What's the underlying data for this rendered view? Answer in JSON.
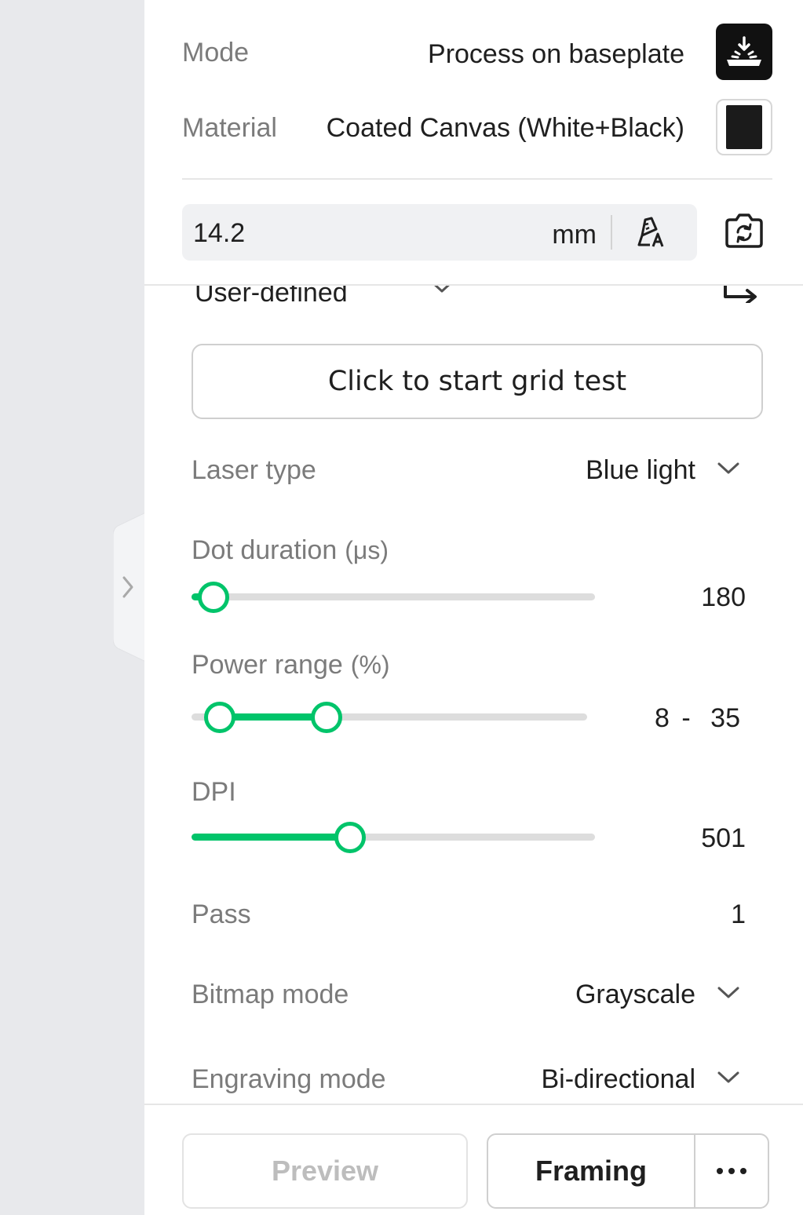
{
  "mode": {
    "label": "Mode",
    "value": "Process on baseplate",
    "icon": "laser-baseplate-icon"
  },
  "material": {
    "label": "Material",
    "value": "Coated Canvas (White+Black)",
    "swatch_color": "#1b1b1b"
  },
  "height": {
    "value": "14.2",
    "unit": "mm",
    "auto_icon": "auto-measure-icon",
    "camera_icon": "camera-refresh-icon"
  },
  "preset": {
    "value": "User-defined",
    "export_icon": "export-arrow-icon"
  },
  "grid_test": {
    "label": "Click to start grid test"
  },
  "laser_type": {
    "label": "Laser type",
    "value": "Blue light"
  },
  "dot_duration": {
    "label": "Dot duration",
    "unit": "(μs)",
    "value": "180",
    "min": 0,
    "max": 2000,
    "current": 180
  },
  "power_range": {
    "label": "Power range",
    "unit": "(%)",
    "value_low": "8",
    "separator": "-",
    "value_high": "35",
    "low": 8,
    "high": 35,
    "min": 0,
    "max": 100
  },
  "dpi": {
    "label": "DPI",
    "value": "501",
    "fraction": 0.39
  },
  "pass": {
    "label": "Pass",
    "value": "1"
  },
  "bitmap_mode": {
    "label": "Bitmap mode",
    "value": "Grayscale"
  },
  "engraving_mode": {
    "label": "Engraving mode",
    "value": "Bi-directional"
  },
  "footer": {
    "preview_label": "Preview",
    "framing_label": "Framing",
    "more_icon": "more-dots-icon"
  },
  "colors": {
    "accent": "#00c46a",
    "muted_text": "#7b7b7b",
    "dark_text": "#1f1f1f",
    "sidebar_bg": "#e8e9ec"
  }
}
